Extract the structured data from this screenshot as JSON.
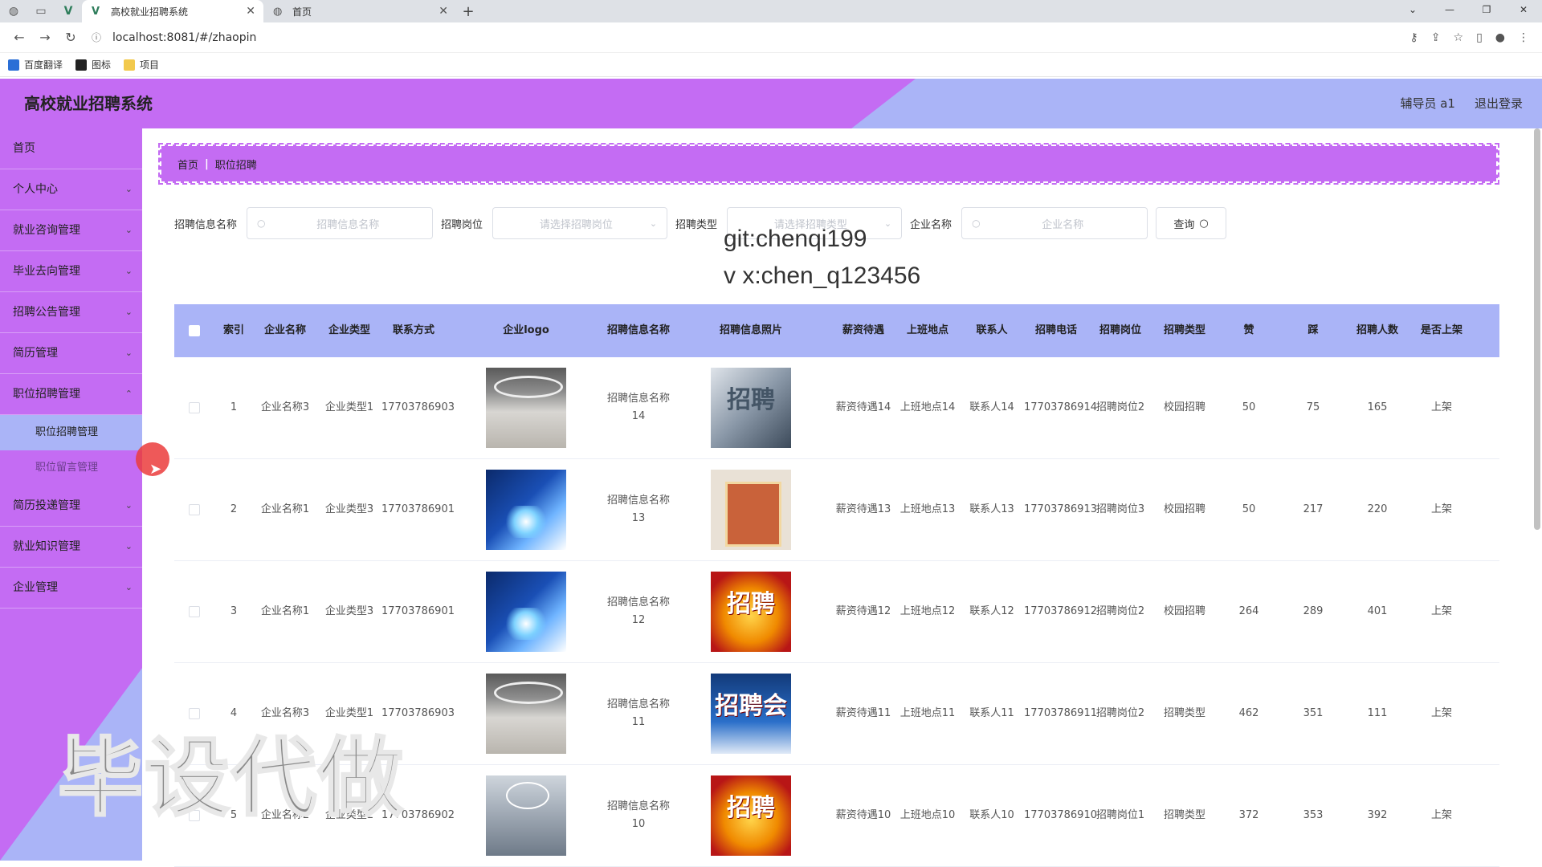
{
  "browser": {
    "tabs": [
      {
        "label": "高校就业招聘系统",
        "active": true
      },
      {
        "label": "首页",
        "active": false
      }
    ],
    "url": "localhost:8081/#/zhaopin",
    "bookmarks": [
      {
        "label": "百度翻译",
        "color": "#2b6fd6"
      },
      {
        "label": "图标",
        "color": "#222222"
      },
      {
        "label": "项目",
        "color": "#f2c94c"
      }
    ]
  },
  "header": {
    "title": "高校就业招聘系统",
    "user": "辅导员 a1",
    "logout": "退出登录"
  },
  "sidebar": {
    "items": [
      {
        "label": "首页",
        "has_children": false
      },
      {
        "label": "个人中心",
        "has_children": true
      },
      {
        "label": "就业咨询管理",
        "has_children": true
      },
      {
        "label": "毕业去向管理",
        "has_children": true
      },
      {
        "label": "招聘公告管理",
        "has_children": true
      },
      {
        "label": "简历管理",
        "has_children": true
      },
      {
        "label": "职位招聘管理",
        "has_children": true
      },
      {
        "label": "职位招聘管理",
        "sub": true,
        "active": true
      },
      {
        "label": "职位留言管理",
        "sub": true,
        "active": false
      },
      {
        "label": "简历投递管理",
        "has_children": true
      },
      {
        "label": "就业知识管理",
        "has_children": true
      },
      {
        "label": "企业管理",
        "has_children": true
      }
    ]
  },
  "breadcrumb": {
    "home": "首页",
    "current": "职位招聘"
  },
  "filters": {
    "info_name_label": "招聘信息名称",
    "info_name_placeholder": "招聘信息名称",
    "position_label": "招聘岗位",
    "position_placeholder": "请选择招聘岗位",
    "type_label": "招聘类型",
    "type_placeholder": "请选择招聘类型",
    "company_label": "企业名称",
    "company_placeholder": "企业名称",
    "query_button": "查询"
  },
  "overlay_text": {
    "line1": "git:chenqi199",
    "line2": "v x:chen_q123456",
    "big": "毕设代做"
  },
  "table": {
    "columns": [
      "索引",
      "企业名称",
      "企业类型",
      "联系方式",
      "企业logo",
      "招聘信息名称",
      "招聘信息照片",
      "薪资待遇",
      "上班地点",
      "联系人",
      "招聘电话",
      "招聘岗位",
      "招聘类型",
      "赞",
      "踩",
      "招聘人数",
      "是否上架"
    ],
    "rows": [
      {
        "idx": "1",
        "name": "企业名称3",
        "type": "企业类型1",
        "phone": "17703786903",
        "logo": "lobby",
        "info": "招聘信息名称14",
        "photo": "steel",
        "photo_text": "招聘",
        "salary": "薪资待遇14",
        "loc": "上班地点14",
        "contact": "联系人14",
        "tel": "17703786914",
        "pos": "招聘岗位2",
        "rtype": "校园招聘",
        "like": "50",
        "dislike": "75",
        "count": "165",
        "status": "上架"
      },
      {
        "idx": "2",
        "name": "企业名称1",
        "type": "企业类型3",
        "phone": "17703786901",
        "logo": "blue",
        "info": "招聘信息名称13",
        "photo": "poster",
        "photo_text": "",
        "salary": "薪资待遇13",
        "loc": "上班地点13",
        "contact": "联系人13",
        "tel": "17703786913",
        "pos": "招聘岗位3",
        "rtype": "校园招聘",
        "like": "50",
        "dislike": "217",
        "count": "220",
        "status": "上架"
      },
      {
        "idx": "3",
        "name": "企业名称1",
        "type": "企业类型3",
        "phone": "17703786901",
        "logo": "blue",
        "info": "招聘信息名称12",
        "photo": "gold",
        "photo_text": "招聘",
        "salary": "薪资待遇12",
        "loc": "上班地点12",
        "contact": "联系人12",
        "tel": "17703786912",
        "pos": "招聘岗位2",
        "rtype": "校园招聘",
        "like": "264",
        "dislike": "289",
        "count": "401",
        "status": "上架"
      },
      {
        "idx": "4",
        "name": "企业名称3",
        "type": "企业类型1",
        "phone": "17703786903",
        "logo": "lobby",
        "info": "招聘信息名称11",
        "photo": "fair",
        "photo_text": "招聘会",
        "salary": "薪资待遇11",
        "loc": "上班地点11",
        "contact": "联系人11",
        "tel": "17703786911",
        "pos": "招聘岗位2",
        "rtype": "招聘类型",
        "like": "462",
        "dislike": "351",
        "count": "111",
        "status": "上架"
      },
      {
        "idx": "5",
        "name": "企业名称2",
        "type": "企业类型2",
        "phone": "17703786902",
        "logo": "hall",
        "info": "招聘信息名称10",
        "photo": "gold",
        "photo_text": "招聘",
        "salary": "薪资待遇10",
        "loc": "上班地点10",
        "contact": "联系人10",
        "tel": "17703786910",
        "pos": "招聘岗位1",
        "rtype": "招聘类型",
        "like": "372",
        "dislike": "353",
        "count": "392",
        "status": "上架"
      }
    ]
  },
  "colors": {
    "purple": "#c46cf3",
    "periwinkle": "#aab4f7"
  }
}
